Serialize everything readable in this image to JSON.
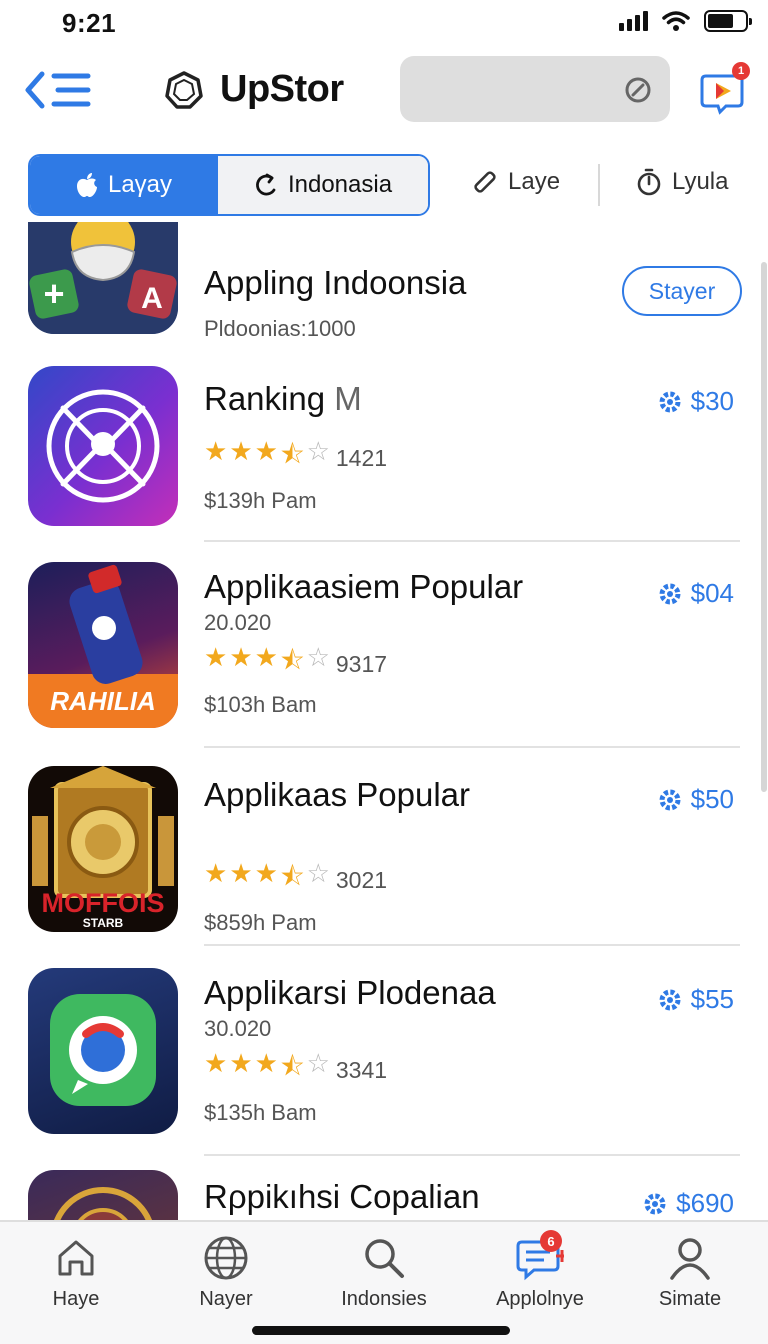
{
  "status_bar": {
    "time": "9:21"
  },
  "header": {
    "title": "UpStor",
    "search": {
      "value": "",
      "placeholder": ""
    },
    "notification_count": "1"
  },
  "tabs": [
    {
      "label": "Laγay",
      "icon": "apple-icon",
      "selected": true
    },
    {
      "label": "Indonasia",
      "icon": "refresh-icon",
      "selected": false
    },
    {
      "label": "Laye",
      "icon": "pen-icon",
      "selected": false
    },
    {
      "label": "Lyula",
      "icon": "timer-icon",
      "selected": false
    }
  ],
  "items": [
    {
      "title": "Appling Indoonsia",
      "subtitle": "Pldoonias:1000",
      "action": "Stayer",
      "icon": "mask-character-app-icon"
    },
    {
      "title": "Ranking",
      "title_suffix": "M",
      "rating_count": "1421",
      "price": "$139h Pam",
      "action": "$30",
      "stars": 3.5,
      "icon": "compass-app-icon"
    },
    {
      "title": "Applikaasiem Popular",
      "subtitle": "20.020",
      "rating_count": "9317",
      "price": "$103h Bam",
      "action": "$04",
      "stars": 3.5,
      "icon": "rahilia-app-icon",
      "icon_text": "RAHILIA"
    },
    {
      "title": "Applikaas Popular",
      "rating_count": "3021",
      "price": "$859h Pam",
      "action": "$50",
      "stars": 3.5,
      "icon": "temple-app-icon",
      "icon_text": "MOFFOIS",
      "icon_subtext": "STARB"
    },
    {
      "title": "Applikarsi Plodenaa",
      "subtitle": "30.020",
      "rating_count": "3341",
      "price": "$135h Bam",
      "action": "$55",
      "stars": 3.5,
      "icon": "chat-app-icon"
    },
    {
      "title": "Rρpikıhsi Copalian",
      "action": "$690",
      "icon": "ornament-app-icon"
    }
  ],
  "bottom_nav": [
    {
      "label": "Haye",
      "icon": "home-icon"
    },
    {
      "label": "Nayer",
      "icon": "globe-icon"
    },
    {
      "label": "Indonsies",
      "icon": "search-icon"
    },
    {
      "label": "Applolnye",
      "icon": "messages-icon",
      "badge": "6"
    },
    {
      "label": "Simate",
      "icon": "profile-icon"
    }
  ],
  "colors": {
    "accent": "#2f7ae5",
    "star": "#f2a81d",
    "badge": "#e53935"
  }
}
